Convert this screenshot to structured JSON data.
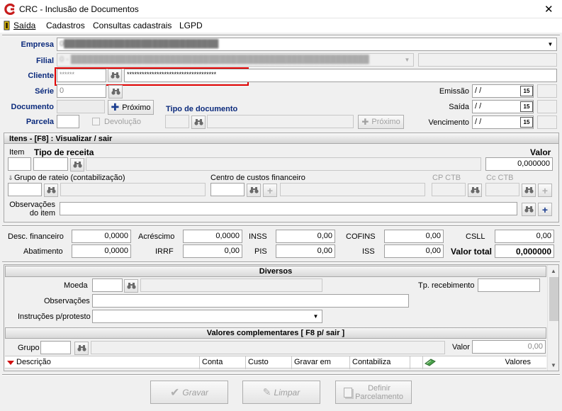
{
  "window": {
    "title": "CRC - Inclusão de Documentos",
    "close_glyph": "✕"
  },
  "menu": [
    {
      "label": "Saída"
    },
    {
      "label": "Cadastros"
    },
    {
      "label": "Consultas cadastrais"
    },
    {
      "label": "LGPD"
    }
  ],
  "header": {
    "empresa_label": "Empresa",
    "empresa_value": "0████████████████████████████",
    "filial_label": "Filial",
    "filial_value": "0 - ██████████████████████████████████████████████████████",
    "cliente_label": "Cliente",
    "cliente_code": "******",
    "cliente_name": "************************************",
    "serie_label": "Série",
    "serie_value": "0",
    "documento_label": "Documento",
    "proximo_label": "Próximo",
    "tipo_documento_label": "Tipo de documento",
    "parcela_label": "Parcela",
    "devolucao_label": "Devolução",
    "proximo2_label": "Próximo",
    "emissao_label": "Emissão",
    "emissao_value": " /  /",
    "saida_label": "Saída",
    "saida_value": " /  /",
    "vencimento_label": "Vencimento",
    "vencimento_value": " /  /",
    "cal_glyph": "15"
  },
  "itens": {
    "title": "Itens  - [F8] : Visualizar / sair",
    "item_label": "Item",
    "tipo_receita_label": "Tipo de receita",
    "valor_label": "Valor",
    "valor_value": "0,000000",
    "grupo_rateio_label": "Grupo de rateio (contabilização)",
    "centro_custos_label": "Centro de custos financeiro",
    "cp_ctb_label": "CP CTB",
    "cc_ctb_label": "Cc CTB",
    "observacoes_label_1": "Observações",
    "observacoes_label_2": "do item"
  },
  "totais": {
    "desc_financeiro_label": "Desc. financeiro",
    "desc_financeiro_value": "0,0000",
    "acrescimo_label": "Acréscimo",
    "acrescimo_value": "0,0000",
    "inss_label": "INSS",
    "inss_value": "0,00",
    "cofins_label": "COFINS",
    "cofins_value": "0,00",
    "csll_label": "CSLL",
    "csll_value": "0,00",
    "abatimento_label": "Abatimento",
    "abatimento_value": "0,0000",
    "irrf_label": "IRRF",
    "irrf_value": "0,00",
    "pis_label": "PIS",
    "pis_value": "0,00",
    "iss_label": "ISS",
    "iss_value": "0,00",
    "valor_total_label": "Valor total",
    "valor_total_value": "0,000000"
  },
  "diversos": {
    "title": "Diversos",
    "moeda_label": "Moeda",
    "tp_recebimento_label": "Tp. recebimento",
    "observacoes_label": "Observações",
    "instrucoes_label": "Instruções p/protesto"
  },
  "complementares": {
    "title": "Valores complementares [ F8 p/ sair ]",
    "grupo_label": "Grupo",
    "valor_label": "Valor",
    "valor_value": "0,00",
    "columns": [
      "Descrição",
      "Conta",
      "Custo",
      "Gravar em",
      "Contabiliza",
      "",
      "Valores"
    ]
  },
  "footer": {
    "gravar_label": "Gravar",
    "limpar_label": "Limpar",
    "definir_label_1": "Definir",
    "definir_label_2": "Parcelamento"
  },
  "colors": {
    "highlight": "#e00000",
    "title_accent": "#0b2a7c"
  }
}
